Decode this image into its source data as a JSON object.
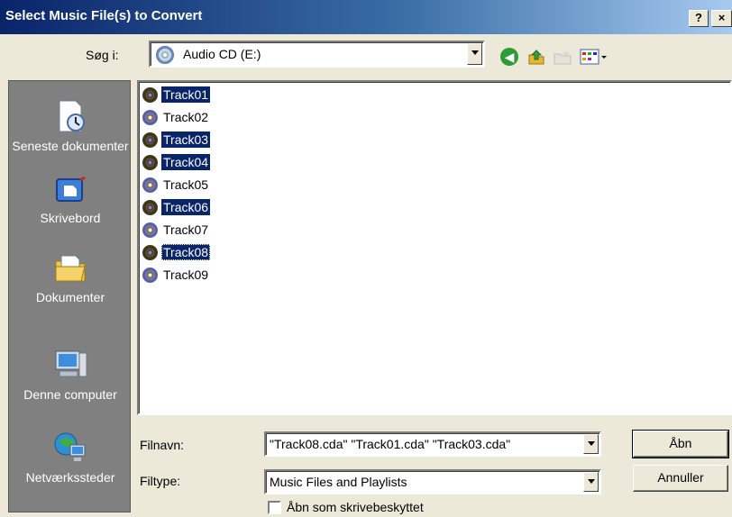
{
  "window": {
    "title": "Select Music File(s) to Convert",
    "help_label": "?",
    "close_label": "×"
  },
  "lookin": {
    "label": "Søg i:",
    "value": "Audio CD (E:)"
  },
  "toolbar": {
    "back_icon": "back-arrow-icon",
    "up_icon": "up-folder-icon",
    "newfolder_icon": "new-folder-icon",
    "views_icon": "views-menu-icon"
  },
  "places": [
    {
      "label": "Seneste dokumenter",
      "icon": "recent-documents-icon"
    },
    {
      "label": "Skrivebord",
      "icon": "desktop-icon"
    },
    {
      "label": "Dokumenter",
      "icon": "my-documents-icon"
    },
    {
      "label": "Denne computer",
      "icon": "my-computer-icon"
    },
    {
      "label": "Netværkssteder",
      "icon": "network-places-icon"
    }
  ],
  "files": [
    {
      "name": "Track01",
      "selected": true
    },
    {
      "name": "Track02",
      "selected": false
    },
    {
      "name": "Track03",
      "selected": true
    },
    {
      "name": "Track04",
      "selected": true
    },
    {
      "name": "Track05",
      "selected": false
    },
    {
      "name": "Track06",
      "selected": true
    },
    {
      "name": "Track07",
      "selected": false
    },
    {
      "name": "Track08",
      "selected": true,
      "focused": true
    },
    {
      "name": "Track09",
      "selected": false
    }
  ],
  "form": {
    "filename_label": "Filnavn:",
    "filename_value": "\"Track08.cda\" \"Track01.cda\" \"Track03.cda\"",
    "filetype_label": "Filtype:",
    "filetype_value": "Music Files and Playlists",
    "readonly_label": "Åbn som skrivebeskyttet",
    "readonly_checked": false,
    "open_label": "Åbn",
    "cancel_label": "Annuller"
  },
  "colors": {
    "selection": "#0a246a",
    "titlebar_start": "#0a246a",
    "titlebar_end": "#a6caf0",
    "places_bg": "#808080"
  }
}
